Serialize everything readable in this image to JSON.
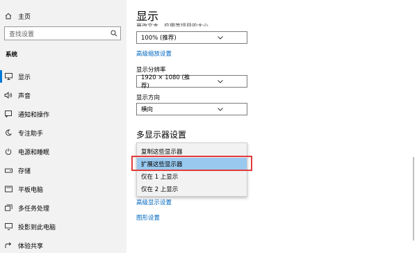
{
  "sidebar": {
    "home_label": "主页",
    "search_placeholder": "查找设置",
    "section_label": "系统",
    "items": [
      {
        "label": "显示",
        "icon": "monitor-icon"
      },
      {
        "label": "声音",
        "icon": "speaker-icon"
      },
      {
        "label": "通知和操作",
        "icon": "notification-icon"
      },
      {
        "label": "专注助手",
        "icon": "moon-icon"
      },
      {
        "label": "电源和睡眠",
        "icon": "power-icon"
      },
      {
        "label": "存储",
        "icon": "storage-icon"
      },
      {
        "label": "平板电脑",
        "icon": "tablet-icon"
      },
      {
        "label": "多任务处理",
        "icon": "multitask-icon"
      },
      {
        "label": "投影到此电脑",
        "icon": "project-icon"
      },
      {
        "label": "体验共享",
        "icon": "share-icon"
      }
    ]
  },
  "main": {
    "title": "显示",
    "clipped_text": "更改文本、应用等项目的大小",
    "scale_value": "100% (推荐)",
    "advanced_scale_link": "高级缩放设置",
    "resolution_label": "显示分辨率",
    "resolution_value": "1920 × 1080 (推荐)",
    "orientation_label": "显示方向",
    "orientation_value": "横向",
    "multi_display_heading": "多显示器设置",
    "menu_options": [
      "复制这些显示器",
      "扩展这些显示器",
      "仅在 1 上显示",
      "仅在 2 上显示"
    ],
    "selected_option_index": 1,
    "advanced_display_link": "高级显示设置",
    "graphics_link": "图形设置"
  },
  "colors": {
    "accent": "#0078d7",
    "link": "#0067c0",
    "highlight": "#99c9ef",
    "annotation_red": "#e23a3a"
  }
}
